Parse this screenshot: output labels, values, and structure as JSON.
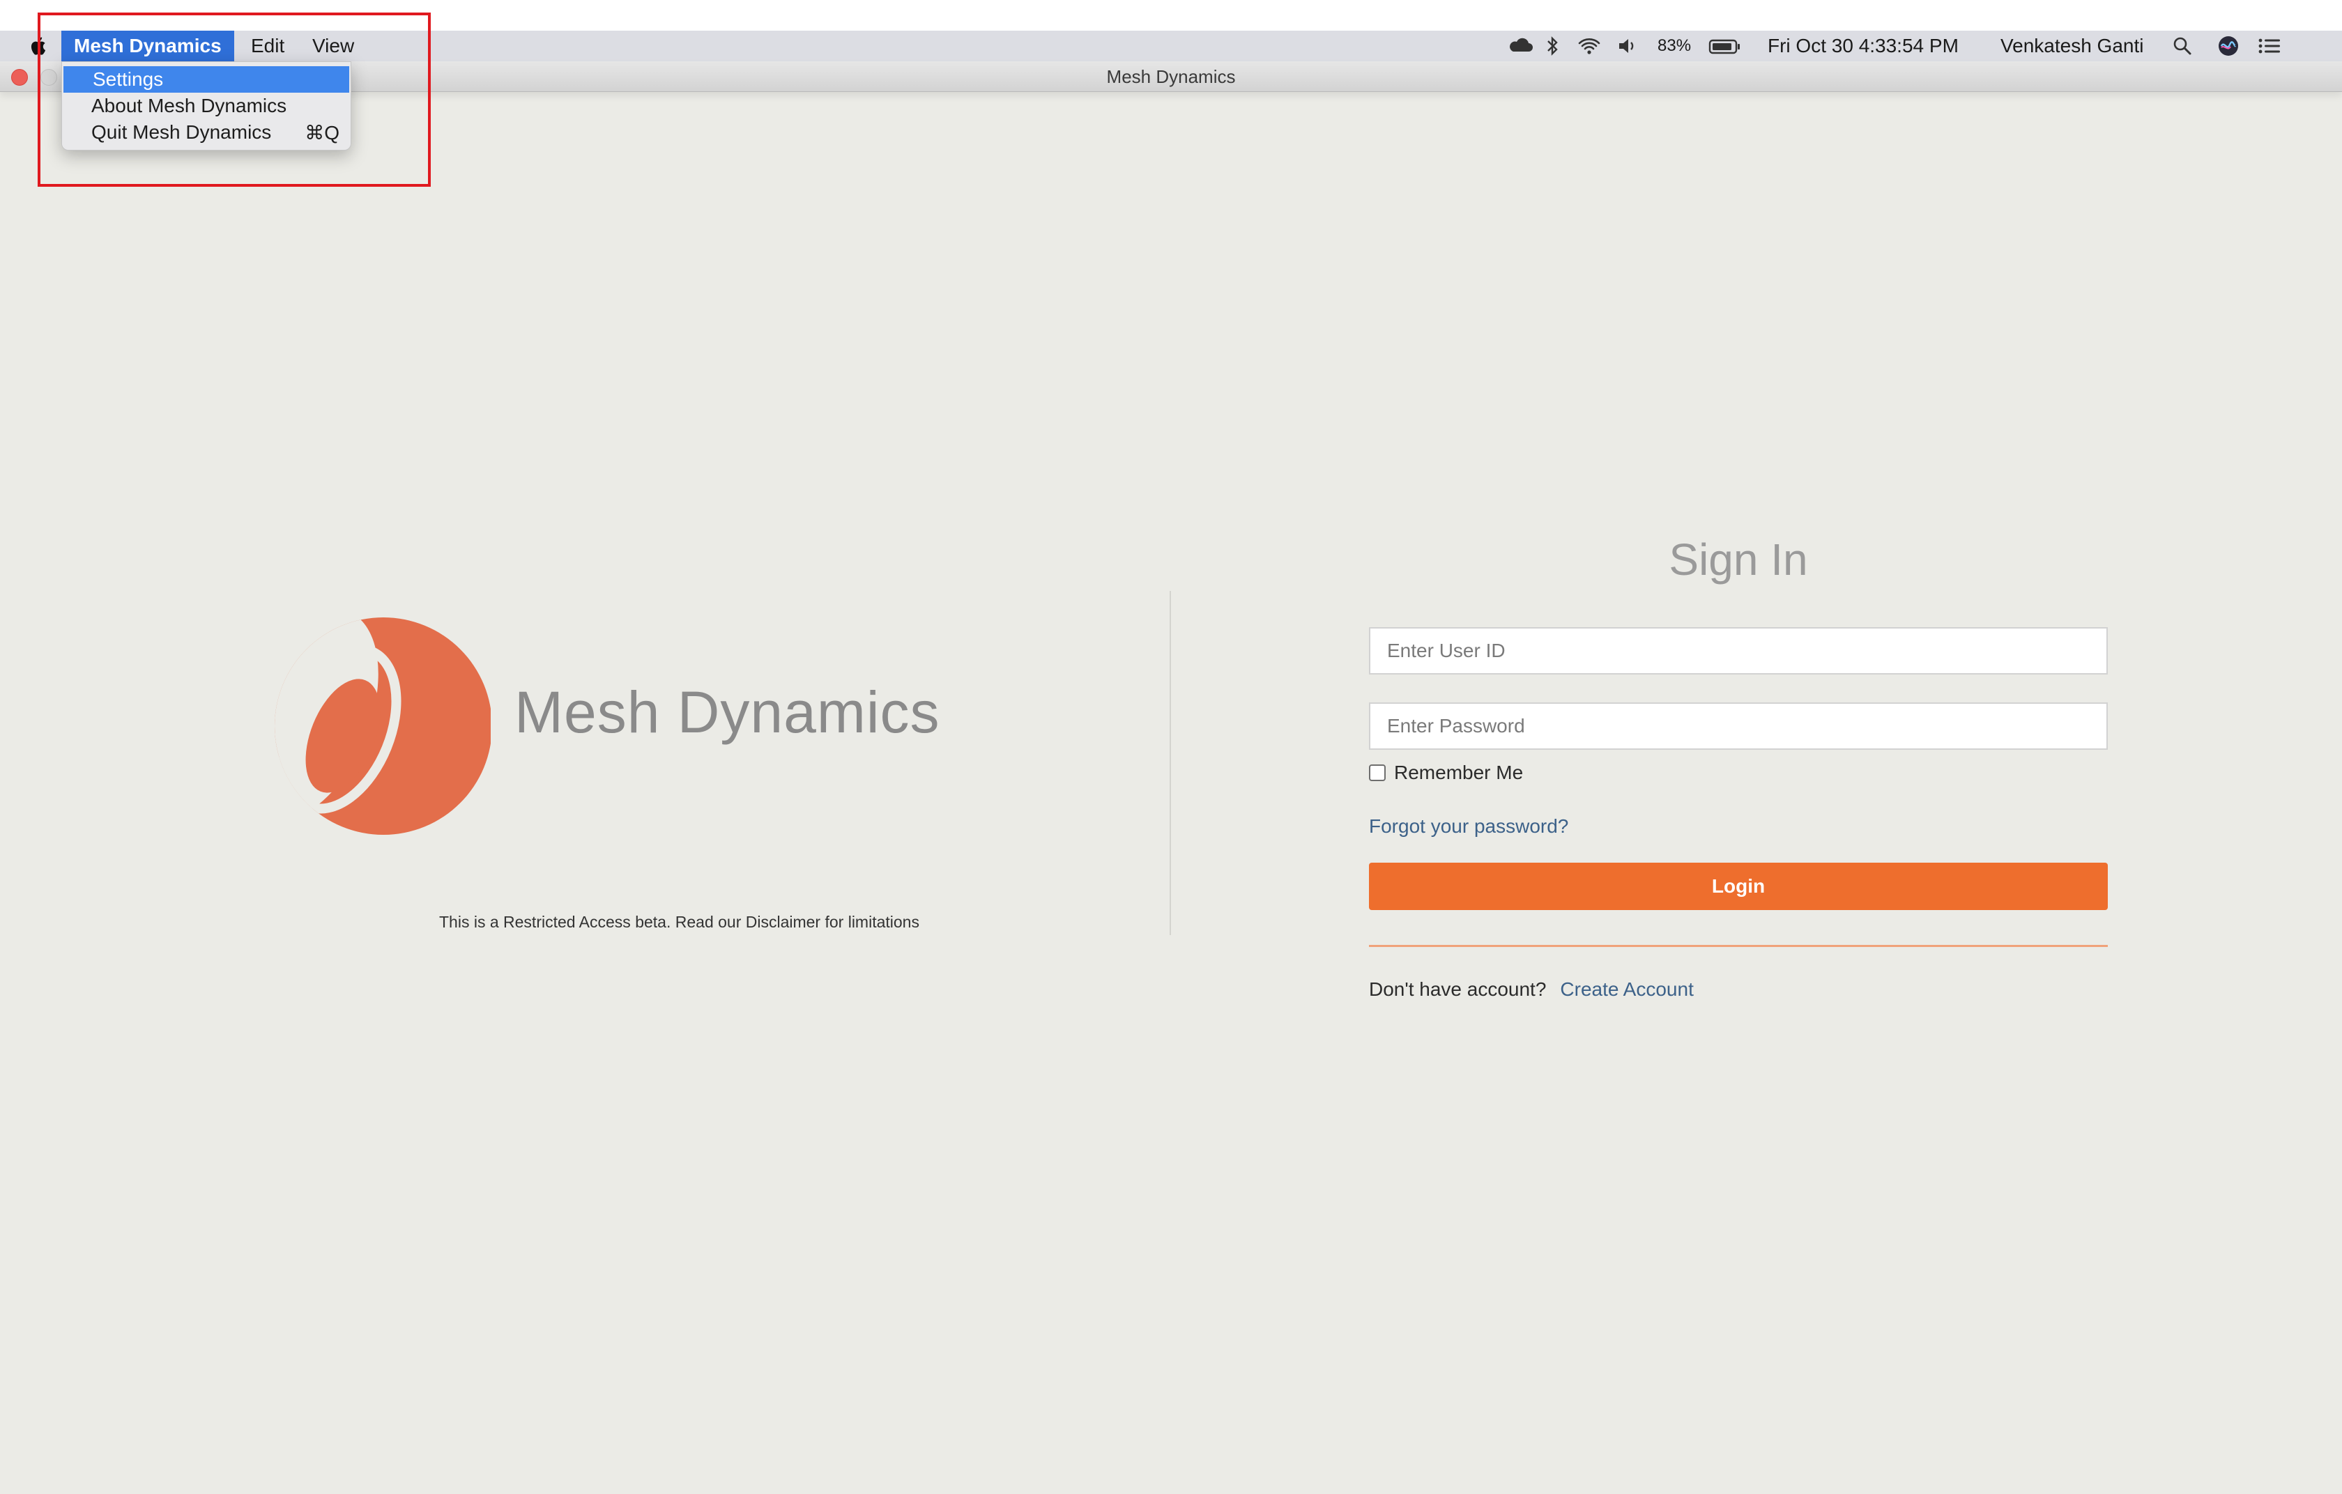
{
  "menubar": {
    "app_menu": "Mesh Dynamics",
    "edit": "Edit",
    "view": "View",
    "battery": "83%",
    "datetime": "Fri Oct 30  4:33:54 PM",
    "user": "Venkatesh Ganti"
  },
  "window": {
    "title": "Mesh Dynamics"
  },
  "dropdown": {
    "items": [
      {
        "label": "Settings",
        "shortcut": ""
      },
      {
        "label": "About Mesh Dynamics",
        "shortcut": ""
      },
      {
        "label": "Quit Mesh Dynamics",
        "shortcut": "⌘Q"
      }
    ]
  },
  "brand": {
    "name": "Mesh Dynamics",
    "disclaimer": "This is a Restricted Access beta. Read our Disclaimer for limitations",
    "logo_color": "#e36e4b"
  },
  "signin": {
    "title": "Sign In",
    "user_id_placeholder": "Enter User ID",
    "password_placeholder": "Enter Password",
    "remember_label": "Remember Me",
    "forgot_label": "Forgot your password?",
    "login_label": "Login",
    "no_account_label": "Don't have account?",
    "create_account_label": "Create Account",
    "accent_color": "#ee6e2d"
  },
  "icons": [
    "apple-icon",
    "cloud-icon",
    "bluetooth-icon",
    "wifi-icon",
    "volume-icon",
    "battery-icon",
    "spotlight-search-icon",
    "siri-icon",
    "notification-center-icon"
  ]
}
